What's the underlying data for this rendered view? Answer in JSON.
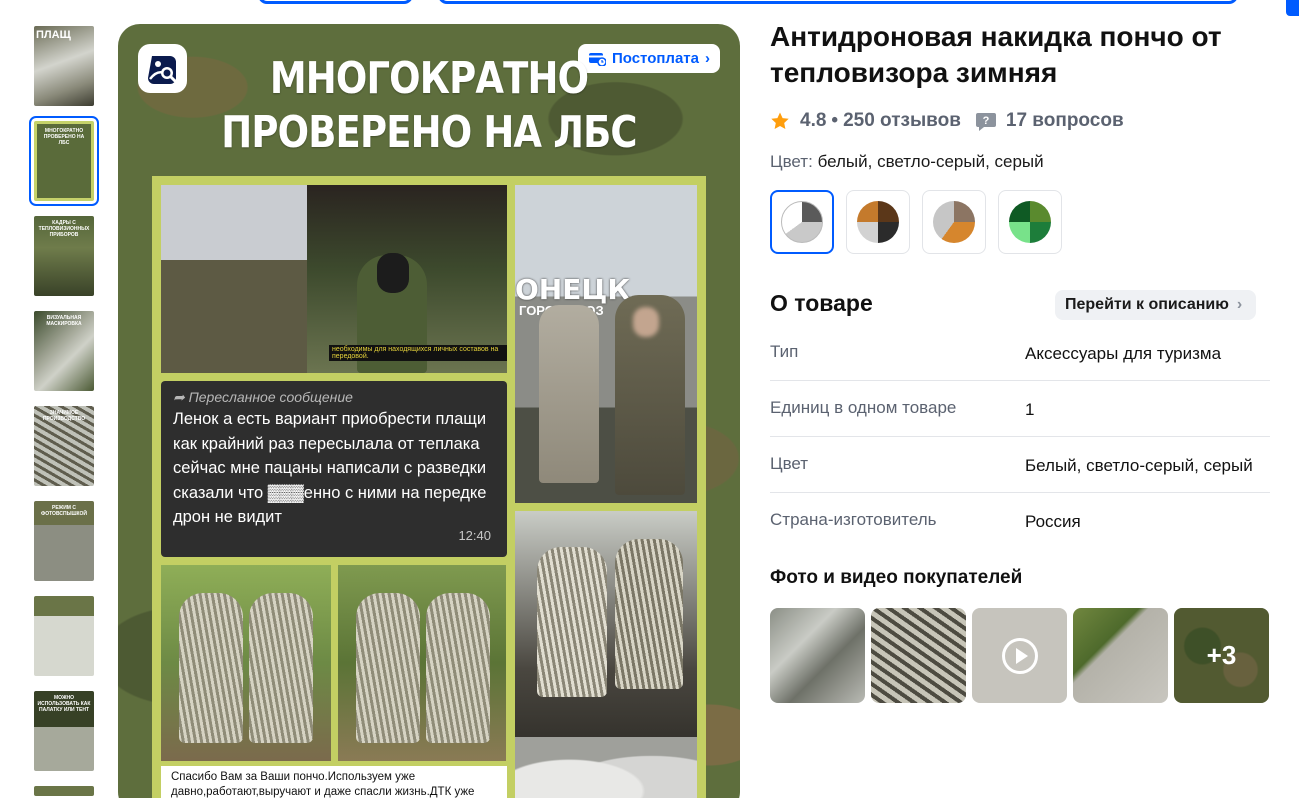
{
  "product": {
    "title": "Антидроновая накидка пончо от тепловизора зимняя",
    "rating": "4.8",
    "separator": "•",
    "reviews": "250 отзывов",
    "questions": "17 вопросов",
    "color_label": "Цвет:",
    "color_value": "белый, светло-серый, серый",
    "swatches": [
      {
        "name": "white-grey",
        "colors": [
          "#ffffff",
          "#5a5a5a",
          "#c9c9c9"
        ]
      },
      {
        "name": "brown",
        "colors": [
          "#5b3719",
          "#c47a2c",
          "#2b2b2b",
          "#d2d2d2"
        ]
      },
      {
        "name": "tan",
        "colors": [
          "#8c7563",
          "#d6862d",
          "#c6c6c6"
        ]
      },
      {
        "name": "green",
        "colors": [
          "#0f5a24",
          "#5a8a2e",
          "#78e28a",
          "#1d7d3a"
        ]
      }
    ]
  },
  "image": {
    "postpay_label": "Постоплата",
    "headline_line1": "МНОГОКРАТНО",
    "headline_line2": "ПРОВЕРЕНО НА ЛБС",
    "photo_caption": "необходимы для находящихся личных составов на передовой.",
    "sign_text": "ОНЕЦК",
    "sign_text2": "ГОРОД ДРОЗ",
    "forwarded_label": "Пересланное сообщение",
    "message_text": "Ленок а есть вариант приобрести плащи как крайний раз пересылала от теплака сейчас мне пацаны написали с разведки сказали что ничего не видит с ними на передке дрон не видит",
    "message_display": "Ленок а есть вариант приобрести плащи как крайний раз пересылала от теплака сейчас мне пацаны написали с разведки сказали что ▓▓▓енно с ними на передке дрон не видит",
    "message_time": "12:40",
    "note_text": "Спасибо Вам за Ваши пончо.Используем уже давно,работают,выручают и даже спасли жизнь.ДТК уже"
  },
  "thumbnails": [
    {
      "caption": "ПЛАЩ"
    },
    {
      "caption": "МНОГОКРАТНО ПРОВЕРЕНО НА ЛБС"
    },
    {
      "caption": "КАДРЫ С ТЕПЛОВИЗИОННЫХ ПРИБОРОВ"
    },
    {
      "caption": "ВИЗУАЛЬНАЯ МАСКИРОВКА"
    },
    {
      "caption": "ЗНАЧИМОЕ ПРОИЗВОДСТВО"
    },
    {
      "caption": "РЕЖИМ С ФОТОВСПЫШКОЙ"
    },
    {
      "caption": ""
    },
    {
      "caption": "МОЖНО ИСПОЛЬЗОВАТЬ КАК ПАЛАТКУ ИЛИ ТЕНТ"
    }
  ],
  "about": {
    "title": "О товаре",
    "goto_label": "Перейти к описанию",
    "specs": [
      {
        "key": "Тип",
        "value": "Аксессуары для туризма"
      },
      {
        "key": "Единиц в одном товаре",
        "value": "1"
      },
      {
        "key": "Цвет",
        "value": "Белый, светло-серый, серый"
      },
      {
        "key": "Страна-изготовитель",
        "value": "Россия"
      }
    ]
  },
  "ugc": {
    "title": "Фото и видео покупателей",
    "more_label": "+3"
  },
  "colors": {
    "accent": "#005bff",
    "star": "#ff9e0d",
    "muted": "#5b6270"
  }
}
